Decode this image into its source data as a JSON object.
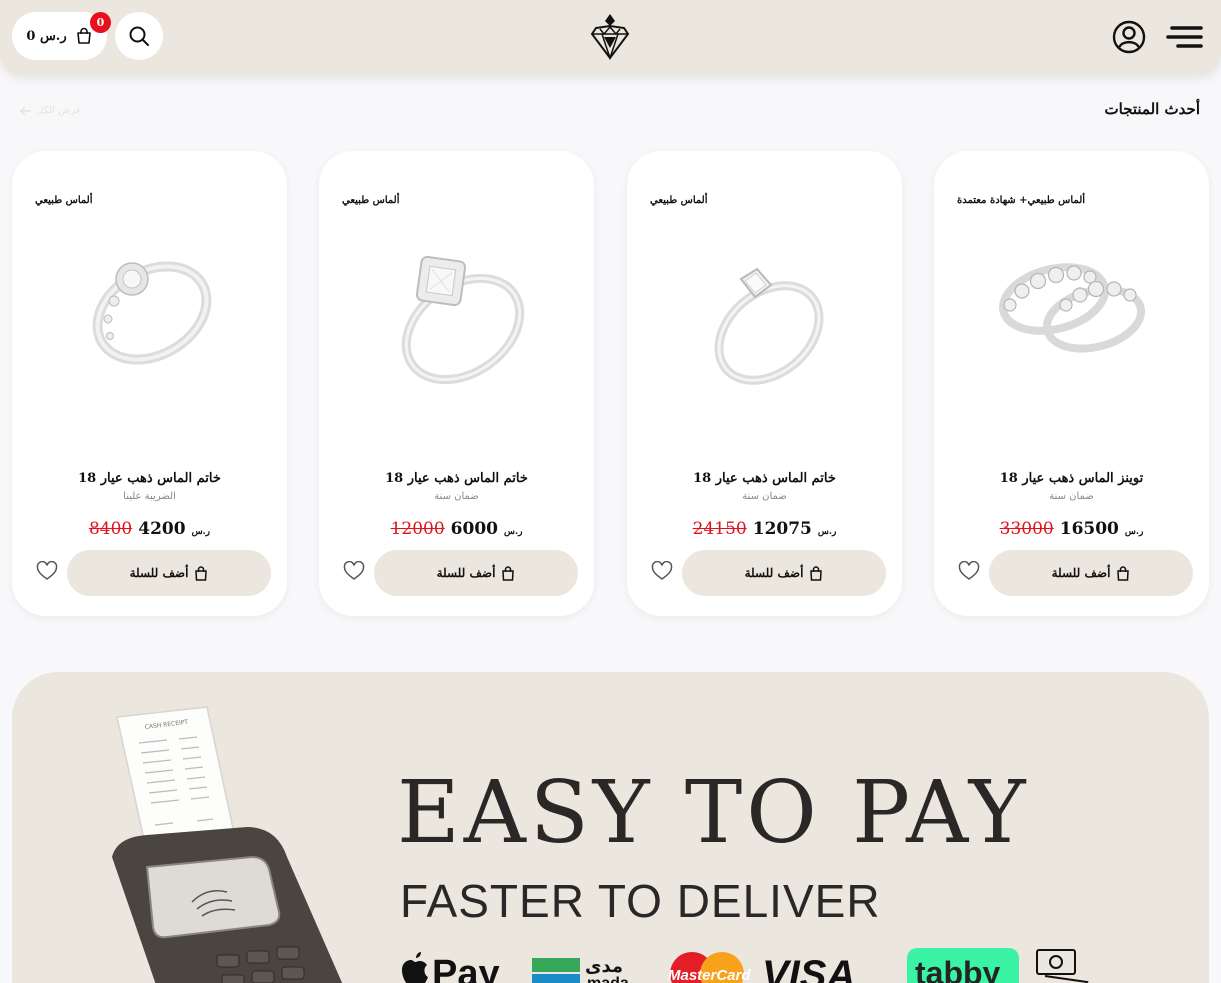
{
  "header": {
    "cart_amount": "0 ر.س",
    "cart_badge": "0"
  },
  "section": {
    "title": "أحدث المنتجات",
    "view_all": "عرض الكل"
  },
  "products": [
    {
      "tag": "ألماس طبيعي",
      "title": "خاتم الماس ذهب عيار 18",
      "subtitle": "الضريبة علينا",
      "price": "4200",
      "old_price": "8400",
      "currency": "ر.س",
      "add_label": "أضف للسلة"
    },
    {
      "tag": "ألماس طبيعي",
      "title": "خاتم الماس ذهب عيار 18",
      "subtitle": "ضمان سنة",
      "price": "6000",
      "old_price": "12000",
      "currency": "ر.س",
      "add_label": "أضف للسلة"
    },
    {
      "tag": "ألماس طبيعي",
      "title": "خاتم الماس ذهب عيار 18",
      "subtitle": "ضمان سنة",
      "price": "12075",
      "old_price": "24150",
      "currency": "ر.س",
      "add_label": "أضف للسلة"
    },
    {
      "tag": "ألماس طبيعي+ شهادة معتمدة",
      "title": "توينز الماس ذهب عيار 18",
      "subtitle": "ضمان سنة",
      "price": "16500",
      "old_price": "33000",
      "currency": "ر.س",
      "add_label": "أضف للسلة"
    }
  ],
  "banner": {
    "headline": "EASY TO PAY",
    "subheadline": "FASTER TO DELIVER",
    "payment_methods": [
      "Apple Pay",
      "مدى mada",
      "MasterCard",
      "VISA",
      "tabby",
      "cash"
    ],
    "receipt_title": "CASH RECEIPT"
  },
  "colors": {
    "header_bg": "#ebe6de",
    "badge": "#e8101c",
    "old_price": "#e0101c"
  }
}
